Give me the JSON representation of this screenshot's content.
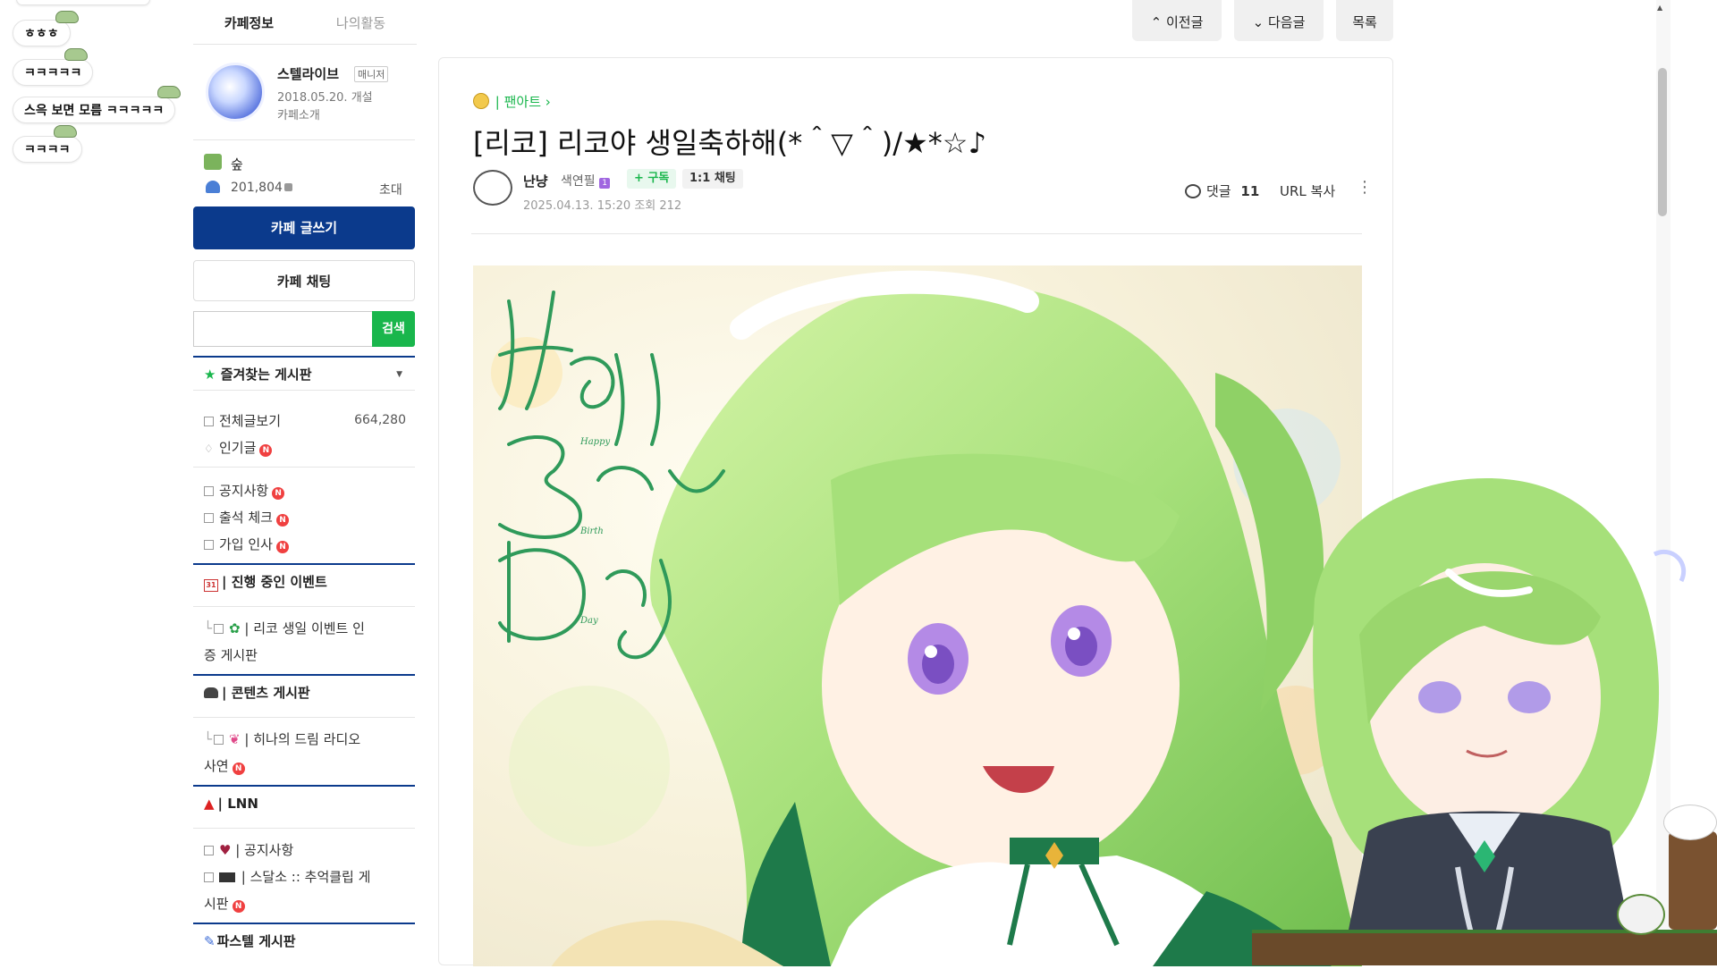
{
  "chat": {
    "messages": [
      {
        "text": "ㅎㅎㅎ"
      },
      {
        "text": "ㅋㅋㅋㅋㅋ"
      },
      {
        "text": "스윽 보면 모름 ㅋㅋㅋㅋㅋ"
      },
      {
        "text": "ㅋㅋㅋㅋ"
      }
    ]
  },
  "sidebar": {
    "tabs": [
      "카페정보",
      "나의활동"
    ],
    "cafe_name": "스텔라이브",
    "manager_badge": "매니저",
    "founded": "2018.05.20. 개설",
    "intro_link": "카페소개",
    "grade": "숲",
    "members": "201,804",
    "invite": "초대",
    "write_button": "카페 글쓰기",
    "chat_button": "카페 채팅",
    "search_button": "검색",
    "favorites_header": "즐겨찾는 게시판",
    "all_posts": "전체글보기",
    "all_posts_count": "664,280",
    "popular": "인기글",
    "notice": "공지사항",
    "attendance": "출석 체크",
    "greeting": "가입 인사",
    "event_header": "| 진행 중인 이벤트",
    "event_item_1": "| 리코 생일 이벤트 인",
    "event_item_2": "증 게시판",
    "contents_header": "| 콘텐츠 게시판",
    "radio_item_1": "| 히나의 드림 라디오",
    "radio_item_2": "사연",
    "lnn_header": "| LNN",
    "lnn_notice": "| 공지사항",
    "clip_item_1": "| 스달소 :: 추억클립 게",
    "clip_item_2": "시판",
    "pastel_header": "파스텔 게시판",
    "new_mark": "N"
  },
  "topnav": {
    "prev": "이전글",
    "next": "다음글",
    "list": "목록"
  },
  "article": {
    "board": "| 팬아트",
    "title": "[리코] 리코야 생일축하해(*＾▽＾)/★*☆♪",
    "author": "난냥",
    "level": "색연필",
    "level_badge": "1",
    "subscribe": "+ 구독",
    "chat": "1:1 채팅",
    "date": "2025.04.13. 15:20",
    "views_label": "조회",
    "views": "212",
    "comments_label": "댓글",
    "comments_count": "11",
    "url_copy": "URL 복사",
    "artwork_text": [
      "Happy",
      "Birth",
      "Day"
    ]
  },
  "colors": {
    "primary": "#0b3a8c",
    "accent": "#19b64c",
    "new_badge": "#f04040",
    "hair": "#a6e07a"
  }
}
